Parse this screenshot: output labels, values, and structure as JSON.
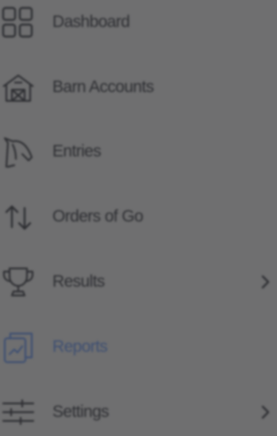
{
  "nav": {
    "items": [
      {
        "label": "Dashboard",
        "icon": "grid-icon",
        "active": false,
        "has_submenu": false
      },
      {
        "label": "Barn Accounts",
        "icon": "barn-icon",
        "active": false,
        "has_submenu": false
      },
      {
        "label": "Entries",
        "icon": "horse-head-icon",
        "active": false,
        "has_submenu": false
      },
      {
        "label": "Orders of Go",
        "icon": "swap-arrows-icon",
        "active": false,
        "has_submenu": false
      },
      {
        "label": "Results",
        "icon": "trophy-icon",
        "active": false,
        "has_submenu": true
      },
      {
        "label": "Reports",
        "icon": "reports-icon",
        "active": true,
        "has_submenu": false
      },
      {
        "label": "Settings",
        "icon": "sliders-icon",
        "active": false,
        "has_submenu": true
      }
    ]
  },
  "colors": {
    "overlay_background": "#6f6f70",
    "text": "#2e2f33",
    "active_text": "#3e4f72"
  }
}
